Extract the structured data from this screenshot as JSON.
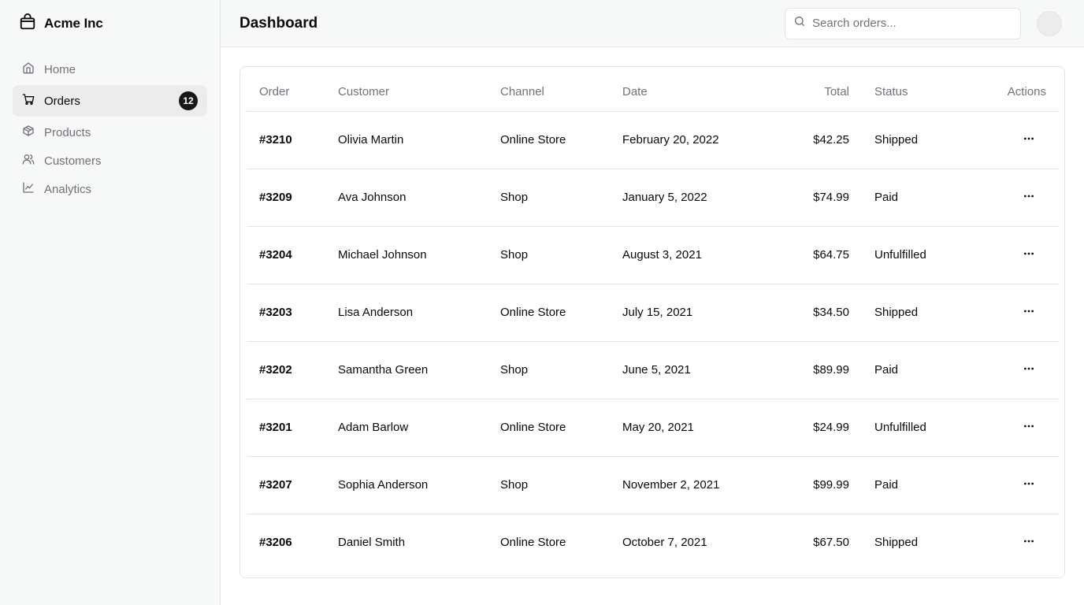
{
  "brand": {
    "name": "Acme Inc",
    "icon": "package-icon"
  },
  "sidebar": {
    "items": [
      {
        "label": "Home",
        "icon": "home-icon"
      },
      {
        "label": "Orders",
        "icon": "cart-icon",
        "badge": "12",
        "active": true
      },
      {
        "label": "Products",
        "icon": "package-icon"
      },
      {
        "label": "Customers",
        "icon": "users-icon"
      },
      {
        "label": "Analytics",
        "icon": "line-chart-icon"
      }
    ]
  },
  "header": {
    "title": "Dashboard",
    "search_placeholder": "Search orders...",
    "search_value": ""
  },
  "table": {
    "columns": [
      "Order",
      "Customer",
      "Channel",
      "Date",
      "Total",
      "Status",
      "Actions"
    ],
    "rows": [
      {
        "order": "#3210",
        "customer": "Olivia Martin",
        "channel": "Online Store",
        "date": "February 20, 2022",
        "total": "$42.25",
        "status": "Shipped"
      },
      {
        "order": "#3209",
        "customer": "Ava Johnson",
        "channel": "Shop",
        "date": "January 5, 2022",
        "total": "$74.99",
        "status": "Paid"
      },
      {
        "order": "#3204",
        "customer": "Michael Johnson",
        "channel": "Shop",
        "date": "August 3, 2021",
        "total": "$64.75",
        "status": "Unfulfilled"
      },
      {
        "order": "#3203",
        "customer": "Lisa Anderson",
        "channel": "Online Store",
        "date": "July 15, 2021",
        "total": "$34.50",
        "status": "Shipped"
      },
      {
        "order": "#3202",
        "customer": "Samantha Green",
        "channel": "Shop",
        "date": "June 5, 2021",
        "total": "$89.99",
        "status": "Paid"
      },
      {
        "order": "#3201",
        "customer": "Adam Barlow",
        "channel": "Online Store",
        "date": "May 20, 2021",
        "total": "$24.99",
        "status": "Unfulfilled"
      },
      {
        "order": "#3207",
        "customer": "Sophia Anderson",
        "channel": "Shop",
        "date": "November 2, 2021",
        "total": "$99.99",
        "status": "Paid"
      },
      {
        "order": "#3206",
        "customer": "Daniel Smith",
        "channel": "Online Store",
        "date": "October 7, 2021",
        "total": "$67.50",
        "status": "Shipped"
      }
    ]
  },
  "colors": {
    "sidebar_bg": "#f7f8f8",
    "border": "#e4e4e7",
    "muted_text": "#71717a",
    "active_bg": "#ececed",
    "badge_bg": "#18181b"
  }
}
